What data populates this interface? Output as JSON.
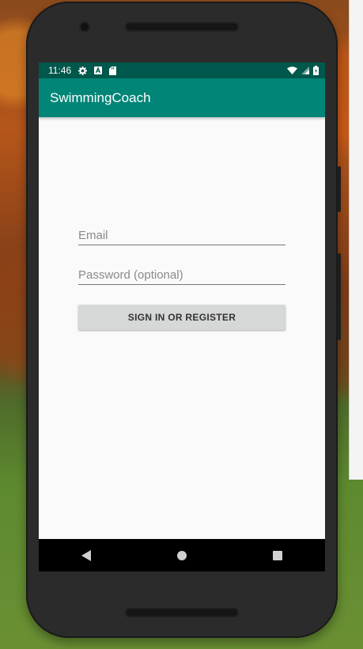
{
  "status_bar": {
    "time": "11:46",
    "left_icons": [
      "gear-icon",
      "accessibility-a-icon",
      "sd-card-icon"
    ],
    "right_icons": [
      "wifi-icon",
      "signal-icon",
      "battery-icon"
    ]
  },
  "app_bar": {
    "title": "SwimmingCoach"
  },
  "form": {
    "email_placeholder": "Email",
    "password_placeholder": "Password (optional)",
    "submit_label": "SIGN IN OR REGISTER"
  },
  "nav_bar": {
    "buttons": [
      "back-icon",
      "home-icon",
      "recents-icon"
    ]
  },
  "colors": {
    "primary": "#008577",
    "primary_dark": "#00574b",
    "screen_bg": "#fafafa",
    "button_bg": "#d6d7d7"
  }
}
